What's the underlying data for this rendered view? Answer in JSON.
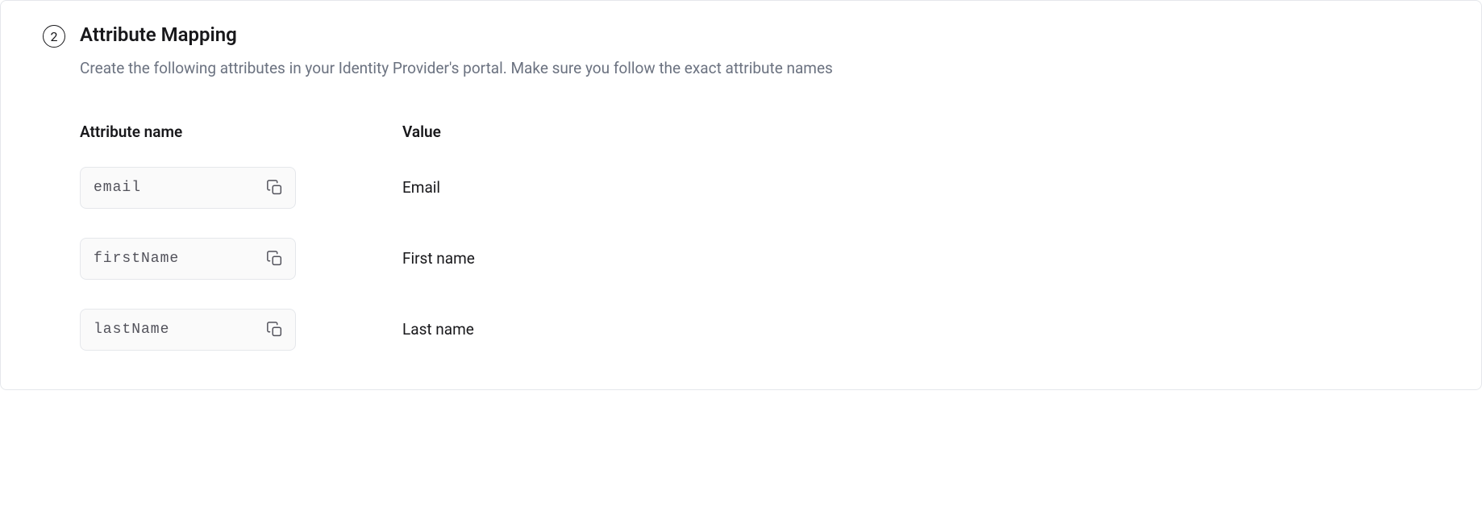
{
  "step": {
    "number": "2",
    "title": "Attribute Mapping",
    "description": "Create the following attributes in your Identity Provider's portal. Make sure you follow the exact attribute names"
  },
  "table": {
    "headers": {
      "name": "Attribute name",
      "value": "Value"
    },
    "rows": [
      {
        "attr": "email",
        "value": "Email"
      },
      {
        "attr": "firstName",
        "value": "First name"
      },
      {
        "attr": "lastName",
        "value": "Last name"
      }
    ]
  }
}
